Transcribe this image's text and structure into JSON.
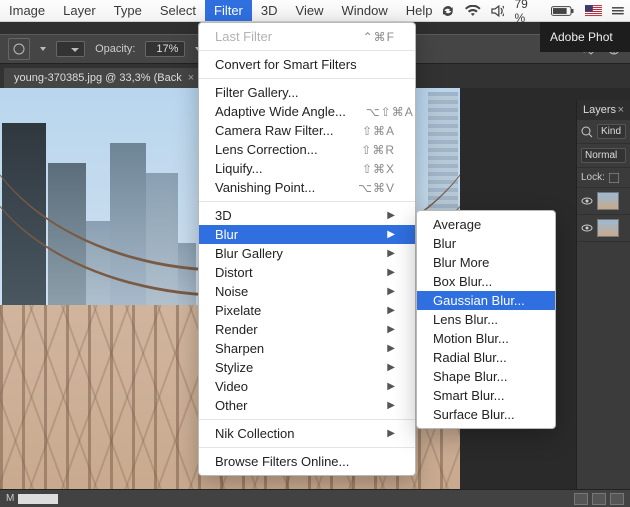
{
  "mac_menu": {
    "items": [
      "Image",
      "Layer",
      "Type",
      "Select",
      "Filter",
      "3D",
      "View",
      "Window",
      "Help"
    ],
    "active_index": 4,
    "battery_pct": "79 %",
    "flag": "US"
  },
  "app_title": "Adobe Phot",
  "options_bar": {
    "opacity_label": "Opacity:",
    "opacity_value": "17%"
  },
  "document_tab": {
    "title": "young-370385.jpg @ 33,3% (Back",
    "close": "×"
  },
  "filter_menu": {
    "last_filter": {
      "label": "Last Filter",
      "shortcut": "⌃⌘F"
    },
    "convert": "Convert for Smart Filters",
    "group1": [
      {
        "label": "Filter Gallery..."
      },
      {
        "label": "Adaptive Wide Angle...",
        "shortcut": "⌥⇧⌘A"
      },
      {
        "label": "Camera Raw Filter...",
        "shortcut": "⇧⌘A"
      },
      {
        "label": "Lens Correction...",
        "shortcut": "⇧⌘R"
      },
      {
        "label": "Liquify...",
        "shortcut": "⇧⌘X"
      },
      {
        "label": "Vanishing Point...",
        "shortcut": "⌥⌘V"
      }
    ],
    "group2": [
      {
        "label": "3D",
        "sub": true
      },
      {
        "label": "Blur",
        "sub": true,
        "highlight": true
      },
      {
        "label": "Blur Gallery",
        "sub": true
      },
      {
        "label": "Distort",
        "sub": true
      },
      {
        "label": "Noise",
        "sub": true
      },
      {
        "label": "Pixelate",
        "sub": true
      },
      {
        "label": "Render",
        "sub": true
      },
      {
        "label": "Sharpen",
        "sub": true
      },
      {
        "label": "Stylize",
        "sub": true
      },
      {
        "label": "Video",
        "sub": true
      },
      {
        "label": "Other",
        "sub": true
      }
    ],
    "nik": {
      "label": "Nik Collection",
      "sub": true
    },
    "browse": "Browse Filters Online..."
  },
  "blur_submenu": {
    "items": [
      "Average",
      "Blur",
      "Blur More",
      "Box Blur...",
      "Gaussian Blur...",
      "Lens Blur...",
      "Motion Blur...",
      "Radial Blur...",
      "Shape Blur...",
      "Smart Blur...",
      "Surface Blur..."
    ],
    "highlight_index": 4
  },
  "layers_panel": {
    "title": "Layers",
    "kind": "Kind",
    "mode": "Normal",
    "lock": "Lock:"
  },
  "bottom_bar": {
    "label": "M"
  }
}
